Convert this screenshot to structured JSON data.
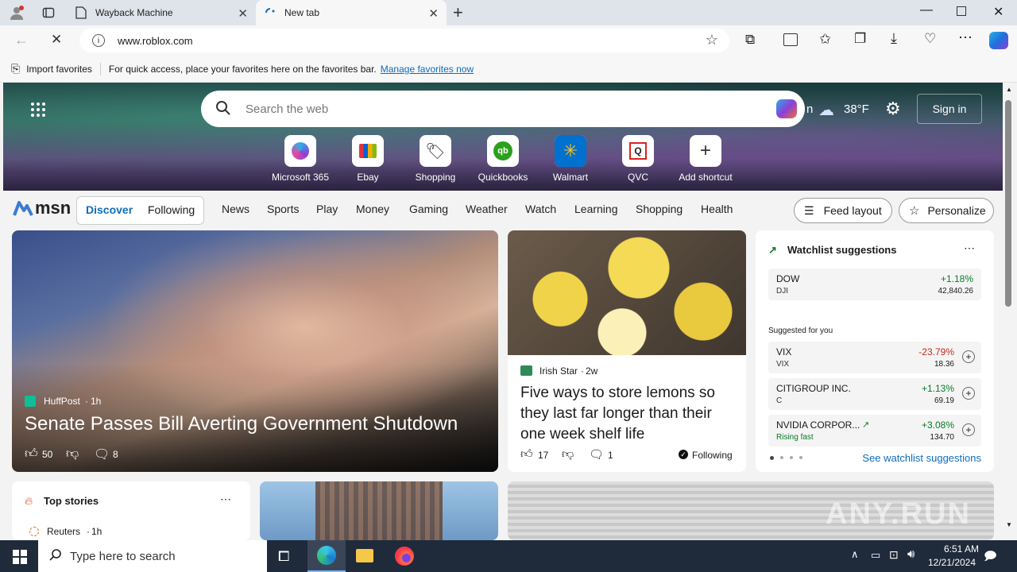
{
  "browser": {
    "tabs": [
      {
        "label": "Wayback Machine"
      },
      {
        "label": "New tab"
      }
    ],
    "url": "www.roblox.com",
    "favorites_bar": {
      "import_label": "Import favorites",
      "hint": "For quick access, place your favorites here on the favorites bar.",
      "manage_link": "Manage favorites now"
    }
  },
  "newtab": {
    "search_placeholder": "Search the web",
    "weather_partial": "n",
    "temperature": "38°F",
    "sign_in": "Sign in",
    "shortcuts": [
      {
        "label": "Microsoft 365"
      },
      {
        "label": "Ebay"
      },
      {
        "label": "Shopping"
      },
      {
        "label": "Quickbooks"
      },
      {
        "label": "Walmart"
      },
      {
        "label": "QVC"
      },
      {
        "label": "Add shortcut"
      }
    ],
    "logo": "msn",
    "tabs": [
      "Discover",
      "Following"
    ],
    "nav_items": [
      "News",
      "Sports",
      "Play",
      "Money",
      "Gaming",
      "Weather",
      "Watch",
      "Learning",
      "Shopping",
      "Health"
    ],
    "feed_layout": "Feed layout",
    "personalize": "Personalize"
  },
  "hero_story": {
    "source": "HuffPost",
    "age": "1h",
    "headline": "Senate Passes Bill Averting Government Shutdown",
    "likes": "50",
    "comments": "8"
  },
  "lemon_story": {
    "source": "Irish Star",
    "age": "2w",
    "headline": "Five ways to store lemons so they last far longer than their one week shelf life",
    "likes": "17",
    "comments": "1",
    "following": "Following"
  },
  "watchlist": {
    "title": "Watchlist suggestions",
    "dow": {
      "name": "DOW",
      "symbol": "DJI",
      "change": "+1.18%",
      "value": "42,840.26"
    },
    "suggested_label": "Suggested for you",
    "items": [
      {
        "name": "VIX",
        "symbol": "VIX",
        "change": "-23.79%",
        "value": "18.36"
      },
      {
        "name": "CITIGROUP INC.",
        "symbol": "C",
        "change": "+1.13%",
        "value": "69.19"
      },
      {
        "name": "NVIDIA CORPOR...",
        "symbol": "Rising fast",
        "change": "+3.08%",
        "value": "134.70"
      }
    ],
    "see_more": "See watchlist suggestions"
  },
  "top_stories": {
    "title": "Top stories",
    "first_source": "Reuters",
    "first_age": "1h"
  },
  "taskbar": {
    "search_placeholder": "Type here to search",
    "time": "6:51 AM",
    "date": "12/21/2024"
  },
  "watermark": "ANY.RUN",
  "colors": {
    "accent": "#0f6cbd",
    "positive": "#0a7a29",
    "negative": "#c42b1c"
  }
}
